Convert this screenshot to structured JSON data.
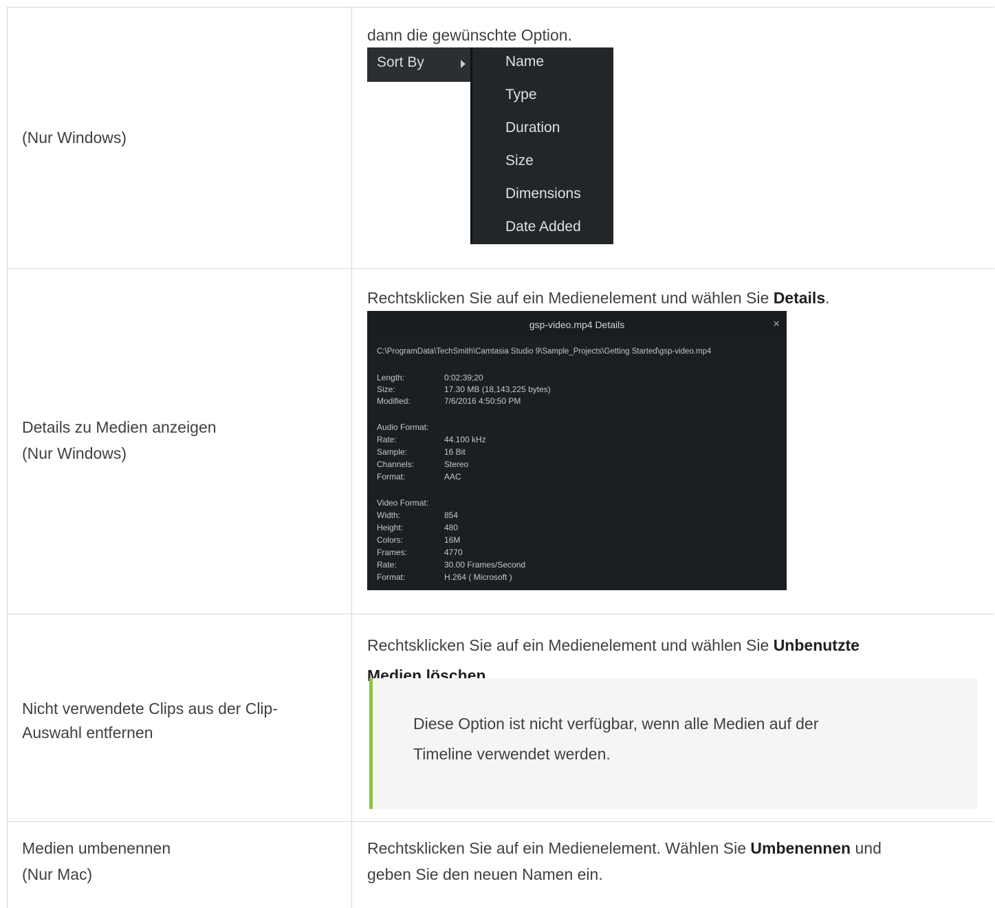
{
  "rows": [
    {
      "left": [
        "(Nur Windows)"
      ],
      "right_text": "dann die gewünschte Option.",
      "sort_menu": {
        "label": "Sort By",
        "items": [
          "Name",
          "Type",
          "Duration",
          "Size",
          "Dimensions",
          "Date Added"
        ]
      }
    },
    {
      "left": [
        "Details zu Medien anzeigen",
        "(Nur Windows)"
      ],
      "right_prefix": "Rechtsklicken Sie auf ein Medienelement und wählen Sie ",
      "right_bold": "Details",
      "right_suffix": ".",
      "details_window": {
        "title": "gsp-video.mp4 Details",
        "close": "×",
        "path": "C:\\ProgramData\\TechSmith\\Camtasia Studio 9\\Sample_Projects\\Getting Started\\gsp-video.mp4",
        "general": [
          {
            "k": "Length:",
            "v": "0:02:39;20"
          },
          {
            "k": "Size:",
            "v": "17.30 MB (18,143,225 bytes)"
          },
          {
            "k": "Modified:",
            "v": "7/6/2016 4:50:50 PM"
          }
        ],
        "audio_header": "Audio Format:",
        "audio": [
          {
            "k": "Rate:",
            "v": "44.100 kHz"
          },
          {
            "k": "Sample:",
            "v": "16 Bit"
          },
          {
            "k": "Channels:",
            "v": "Stereo"
          },
          {
            "k": "Format:",
            "v": "AAC"
          }
        ],
        "video_header": "Video Format:",
        "video": [
          {
            "k": "Width:",
            "v": "854"
          },
          {
            "k": "Height:",
            "v": "480"
          },
          {
            "k": "Colors:",
            "v": "16M"
          },
          {
            "k": "Frames:",
            "v": "4770"
          },
          {
            "k": "Rate:",
            "v": "30.00 Frames/Second"
          },
          {
            "k": "Format:",
            "v": "H.264 ( Microsoft )"
          }
        ]
      }
    },
    {
      "left": [
        "Nicht verwendete Clips aus der Clip-",
        "Auswahl entfernen"
      ],
      "right_prefix": "Rechtsklicken Sie auf ein Medienelement und wählen Sie ",
      "right_bold_1": "Unbenutzte",
      "right_bold_2": "Medien löschen",
      "right_suffix": ".",
      "note_line_1": "Diese Option ist nicht verfügbar, wenn alle Medien auf der",
      "note_line_2": "Timeline verwendet werden."
    },
    {
      "left": [
        "Medien umbenennen",
        "(Nur Mac)"
      ],
      "right_prefix": "Rechtsklicken Sie auf ein Medienelement. Wählen Sie ",
      "right_bold": "Umbenennen",
      "right_suffix_1": " und",
      "right_suffix_2": "geben Sie den neuen Namen ein."
    }
  ]
}
